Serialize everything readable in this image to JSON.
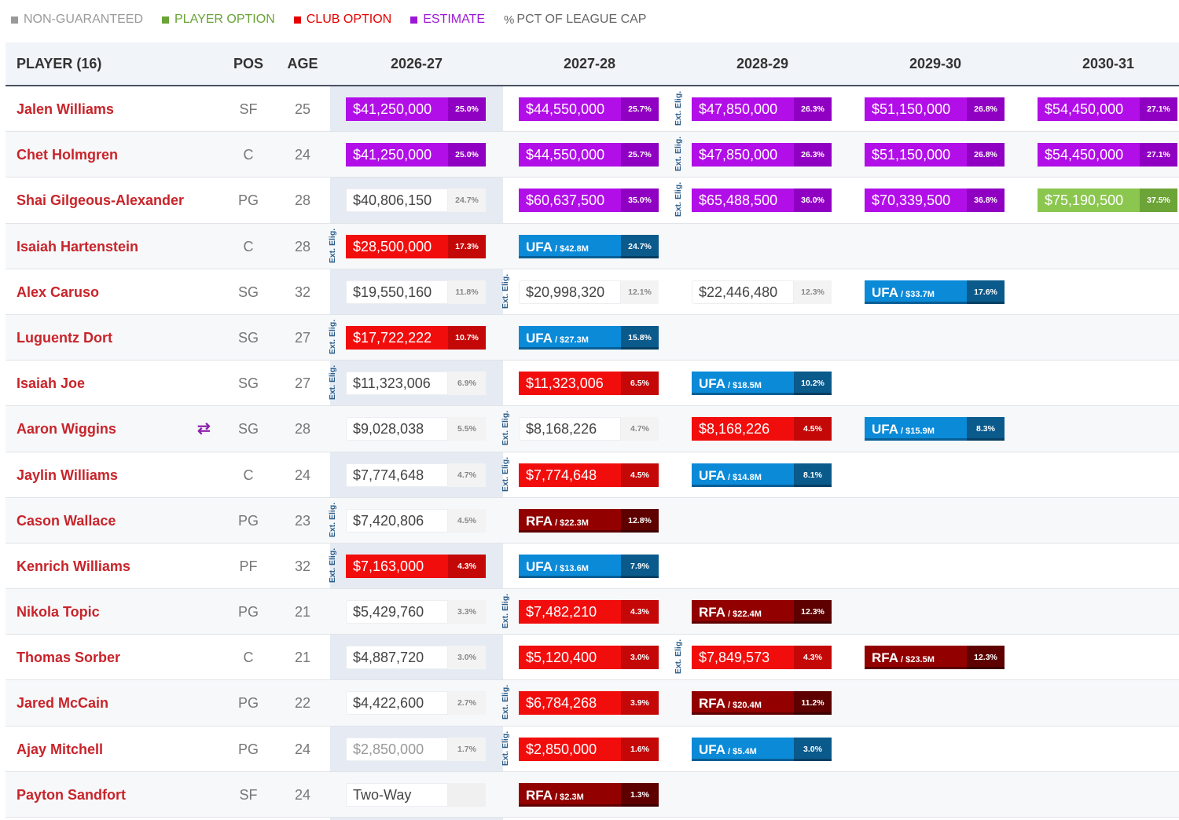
{
  "legend": [
    {
      "label": "NON-GUARANTEED",
      "color": "#9a9a9a"
    },
    {
      "label": "PLAYER OPTION",
      "color": "#6aa336"
    },
    {
      "label": "CLUB OPTION",
      "color": "#e60000"
    },
    {
      "label": "ESTIMATE",
      "color": "#9b19d6"
    },
    {
      "label": "PCT OF LEAGUE CAP",
      "color": "#666666",
      "symbol": "%"
    }
  ],
  "header": {
    "player": "PLAYER (16)",
    "pos": "POS",
    "age": "AGE",
    "years": [
      "2026-27",
      "2027-28",
      "2028-29",
      "2029-30",
      "2030-31"
    ]
  },
  "ext_elig_label": "Ext. Elig.",
  "players": [
    {
      "name": "Jalen Williams",
      "pos": "SF",
      "age": "25",
      "cells": [
        {
          "type": "est",
          "amount": "$41,250,000",
          "pct": "25.0%"
        },
        {
          "type": "est",
          "amount": "$44,550,000",
          "pct": "25.7%"
        },
        {
          "type": "est",
          "amount": "$47,850,000",
          "pct": "26.3%",
          "elig": true
        },
        {
          "type": "est",
          "amount": "$51,150,000",
          "pct": "26.8%"
        },
        {
          "type": "est",
          "amount": "$54,450,000",
          "pct": "27.1%"
        }
      ]
    },
    {
      "name": "Chet Holmgren",
      "pos": "C",
      "age": "24",
      "cells": [
        {
          "type": "est",
          "amount": "$41,250,000",
          "pct": "25.0%"
        },
        {
          "type": "est",
          "amount": "$44,550,000",
          "pct": "25.7%"
        },
        {
          "type": "est",
          "amount": "$47,850,000",
          "pct": "26.3%",
          "elig": true
        },
        {
          "type": "est",
          "amount": "$51,150,000",
          "pct": "26.8%"
        },
        {
          "type": "est",
          "amount": "$54,450,000",
          "pct": "27.1%"
        }
      ]
    },
    {
      "name": "Shai Gilgeous-Alexander",
      "pos": "PG",
      "age": "28",
      "cells": [
        {
          "type": "guar",
          "amount": "$40,806,150",
          "pct": "24.7%"
        },
        {
          "type": "est",
          "amount": "$60,637,500",
          "pct": "35.0%"
        },
        {
          "type": "est",
          "amount": "$65,488,500",
          "pct": "36.0%",
          "elig": true
        },
        {
          "type": "est",
          "amount": "$70,339,500",
          "pct": "36.8%"
        },
        {
          "type": "player",
          "amount": "$75,190,500",
          "pct": "37.5%"
        }
      ]
    },
    {
      "name": "Isaiah Hartenstein",
      "pos": "C",
      "age": "28",
      "cells": [
        {
          "type": "club",
          "amount": "$28,500,000",
          "pct": "17.3%",
          "elig": true
        },
        {
          "type": "ufa",
          "main": "UFA",
          "sub": " / $42.8M",
          "pct": "24.7%"
        },
        null,
        null,
        null
      ]
    },
    {
      "name": "Alex Caruso",
      "pos": "SG",
      "age": "32",
      "cells": [
        {
          "type": "guar",
          "amount": "$19,550,160",
          "pct": "11.8%"
        },
        {
          "type": "guar",
          "amount": "$20,998,320",
          "pct": "12.1%",
          "elig": true
        },
        {
          "type": "guar",
          "amount": "$22,446,480",
          "pct": "12.3%"
        },
        {
          "type": "ufa",
          "main": "UFA",
          "sub": " / $33.7M",
          "pct": "17.6%"
        },
        null
      ]
    },
    {
      "name": "Luguentz Dort",
      "pos": "SG",
      "age": "27",
      "cells": [
        {
          "type": "club",
          "amount": "$17,722,222",
          "pct": "10.7%",
          "elig": true
        },
        {
          "type": "ufa",
          "main": "UFA",
          "sub": " / $27.3M",
          "pct": "15.8%"
        },
        null,
        null,
        null
      ]
    },
    {
      "name": "Isaiah Joe",
      "pos": "SG",
      "age": "27",
      "cells": [
        {
          "type": "guar",
          "amount": "$11,323,006",
          "pct": "6.9%",
          "elig": true
        },
        {
          "type": "club",
          "amount": "$11,323,006",
          "pct": "6.5%"
        },
        {
          "type": "ufa",
          "main": "UFA",
          "sub": " / $18.5M",
          "pct": "10.2%"
        },
        null,
        null
      ]
    },
    {
      "name": "Aaron Wiggins",
      "pos": "SG",
      "age": "28",
      "trade": true,
      "cells": [
        {
          "type": "guar",
          "amount": "$9,028,038",
          "pct": "5.5%"
        },
        {
          "type": "guar",
          "amount": "$8,168,226",
          "pct": "4.7%",
          "elig": true
        },
        {
          "type": "club",
          "amount": "$8,168,226",
          "pct": "4.5%"
        },
        {
          "type": "ufa",
          "main": "UFA",
          "sub": " / $15.9M",
          "pct": "8.3%"
        },
        null
      ]
    },
    {
      "name": "Jaylin Williams",
      "pos": "C",
      "age": "24",
      "cells": [
        {
          "type": "guar",
          "amount": "$7,774,648",
          "pct": "4.7%"
        },
        {
          "type": "club",
          "amount": "$7,774,648",
          "pct": "4.5%",
          "elig": true
        },
        {
          "type": "ufa",
          "main": "UFA",
          "sub": " / $14.8M",
          "pct": "8.1%"
        },
        null,
        null
      ]
    },
    {
      "name": "Cason Wallace",
      "pos": "PG",
      "age": "23",
      "cells": [
        {
          "type": "guar",
          "amount": "$7,420,806",
          "pct": "4.5%",
          "elig": true
        },
        {
          "type": "rfa",
          "main": "RFA",
          "sub": " / $22.3M",
          "pct": "12.8%"
        },
        null,
        null,
        null
      ]
    },
    {
      "name": "Kenrich Williams",
      "pos": "PF",
      "age": "32",
      "cells": [
        {
          "type": "club",
          "amount": "$7,163,000",
          "pct": "4.3%",
          "elig": true
        },
        {
          "type": "ufa",
          "main": "UFA",
          "sub": " / $13.6M",
          "pct": "7.9%"
        },
        null,
        null,
        null
      ]
    },
    {
      "name": "Nikola Topic",
      "pos": "PG",
      "age": "21",
      "cells": [
        {
          "type": "guar",
          "amount": "$5,429,760",
          "pct": "3.3%"
        },
        {
          "type": "club",
          "amount": "$7,482,210",
          "pct": "4.3%",
          "elig": true
        },
        {
          "type": "rfa",
          "main": "RFA",
          "sub": " / $22.4M",
          "pct": "12.3%"
        },
        null,
        null
      ]
    },
    {
      "name": "Thomas Sorber",
      "pos": "C",
      "age": "21",
      "cells": [
        {
          "type": "guar",
          "amount": "$4,887,720",
          "pct": "3.0%"
        },
        {
          "type": "club",
          "amount": "$5,120,400",
          "pct": "3.0%"
        },
        {
          "type": "club",
          "amount": "$7,849,573",
          "pct": "4.3%",
          "elig": true
        },
        {
          "type": "rfa",
          "main": "RFA",
          "sub": " / $23.5M",
          "pct": "12.3%"
        },
        null
      ]
    },
    {
      "name": "Jared McCain",
      "pos": "PG",
      "age": "22",
      "cells": [
        {
          "type": "guar",
          "amount": "$4,422,600",
          "pct": "2.7%"
        },
        {
          "type": "club",
          "amount": "$6,784,268",
          "pct": "3.9%",
          "elig": true
        },
        {
          "type": "rfa",
          "main": "RFA",
          "sub": " / $20.4M",
          "pct": "11.2%"
        },
        null,
        null
      ]
    },
    {
      "name": "Ajay Mitchell",
      "pos": "PG",
      "age": "24",
      "cells": [
        {
          "type": "guar dim",
          "amount": "$2,850,000",
          "pct": "1.7%"
        },
        {
          "type": "club",
          "amount": "$2,850,000",
          "pct": "1.6%",
          "elig": true
        },
        {
          "type": "ufa",
          "main": "UFA",
          "sub": " / $5.4M",
          "pct": "3.0%"
        },
        null,
        null
      ]
    },
    {
      "name": "Payton Sandfort",
      "pos": "SF",
      "age": "24",
      "cells": [
        {
          "type": "twoway",
          "amount": "Two-Way",
          "pct": ""
        },
        {
          "type": "rfa",
          "main": "RFA",
          "sub": " / $2.3M",
          "pct": "1.3%"
        },
        null,
        null,
        null
      ]
    }
  ]
}
